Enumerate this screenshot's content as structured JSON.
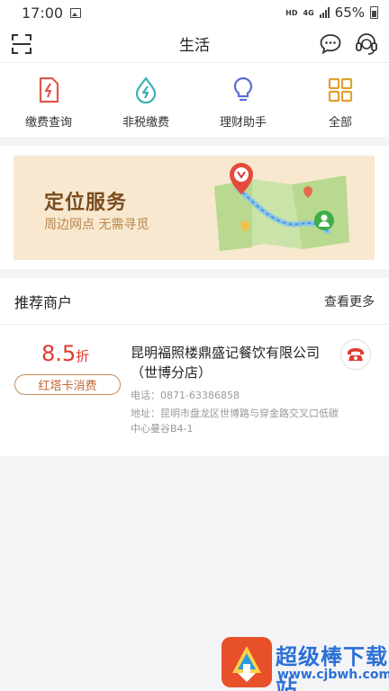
{
  "status_bar": {
    "time": "17:00",
    "hd": "HD",
    "network": "4G",
    "battery": "65%"
  },
  "header": {
    "title": "生活"
  },
  "quick_actions": [
    {
      "label": "缴费查询",
      "icon": "bill-query-icon",
      "color": "#e3564a"
    },
    {
      "label": "非税缴费",
      "icon": "lightning-drop-icon",
      "color": "#3bb0b0"
    },
    {
      "label": "理财助手",
      "icon": "lightbulb-icon",
      "color": "#5a6fd6"
    },
    {
      "label": "全部",
      "icon": "grid-icon",
      "color": "#e0a030"
    }
  ],
  "banner": {
    "title": "定位服务",
    "subtitle": "周边网点 无需寻觅"
  },
  "recommend": {
    "title": "推荐商户",
    "more": "查看更多",
    "merchant": {
      "discount": "8.5",
      "discount_unit": "折",
      "card_tag": "红塔卡消费",
      "name": "昆明福照楼鼎盛记餐饮有限公司（世博分店）",
      "phone": "电话：0871-63386858",
      "address": "地址：昆明市盘龙区世博路与穿金路交叉口低碳中心曼谷B4-1"
    }
  },
  "watermark": {
    "title": "超级棒下载站",
    "url": "www.cjbwh.com"
  },
  "colors": {
    "accent_red": "#e03a2e",
    "banner_bg": "#f8e8d0"
  }
}
